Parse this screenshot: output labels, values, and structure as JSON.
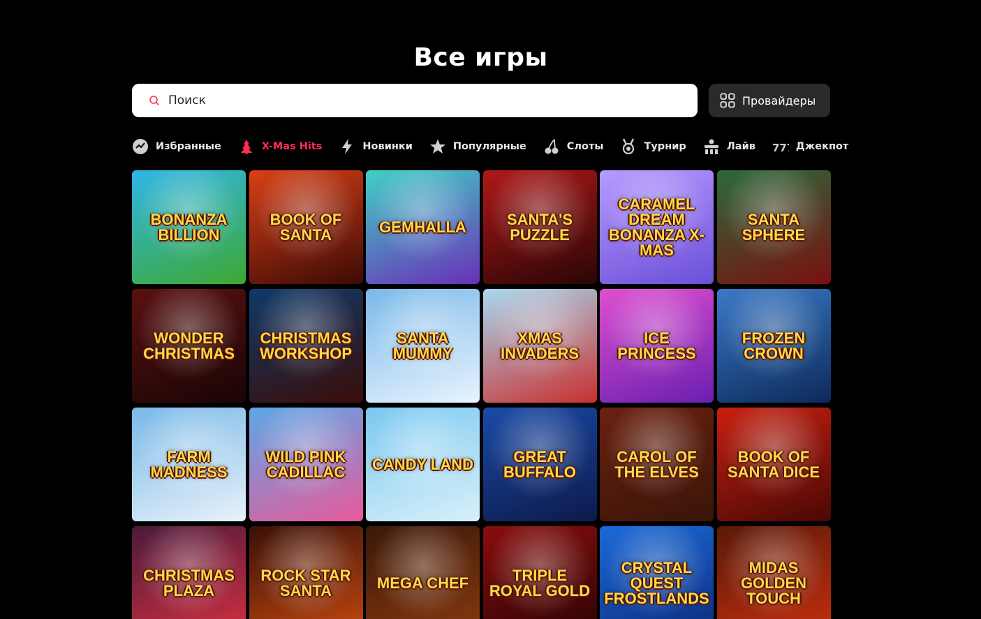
{
  "page": {
    "title": "Все игры"
  },
  "search": {
    "placeholder": "Поиск",
    "value": ""
  },
  "providers_button": {
    "label": "Провайдеры"
  },
  "accent_color": "#ff2d55",
  "categories": [
    {
      "label": "Избранные",
      "icon": "favorites-icon",
      "active": false
    },
    {
      "label": "X-Mas Hits",
      "icon": "christmas-tree-icon",
      "active": true
    },
    {
      "label": "Новинки",
      "icon": "lightning-icon",
      "active": false
    },
    {
      "label": "Популярные",
      "icon": "star-icon",
      "active": false
    },
    {
      "label": "Слоты",
      "icon": "cherry-icon",
      "active": false
    },
    {
      "label": "Турнир",
      "icon": "medal-icon",
      "active": false
    },
    {
      "label": "Лайв",
      "icon": "live-dealer-icon",
      "active": false
    },
    {
      "label": "Джекпот",
      "icon": "jackpot-777-icon",
      "active": false
    }
  ],
  "games": [
    {
      "title": "Bonanza Billion",
      "colors": [
        "#2fb6e8",
        "#3ea832"
      ]
    },
    {
      "title": "Book of Santa",
      "colors": [
        "#d94016",
        "#3c0a05"
      ]
    },
    {
      "title": "Gemhalla",
      "colors": [
        "#3fd1c4",
        "#6b2fb8"
      ]
    },
    {
      "title": "Santa's Puzzle",
      "colors": [
        "#b01818",
        "#2a0505"
      ]
    },
    {
      "title": "Caramel Dream Bonanza X-mas",
      "colors": [
        "#b79bff",
        "#6b4fd8"
      ]
    },
    {
      "title": "Santa Sphere",
      "colors": [
        "#2a6a3a",
        "#7a1010"
      ]
    },
    {
      "title": "Wonder Christmas",
      "colors": [
        "#5a1010",
        "#1a0505"
      ]
    },
    {
      "title": "Christmas Workshop",
      "colors": [
        "#0f3a6a",
        "#3a0d08"
      ]
    },
    {
      "title": "Santa Mummy",
      "colors": [
        "#7ab8e8",
        "#e8f4ff"
      ]
    },
    {
      "title": "Xmas Invaders",
      "colors": [
        "#a8d8f0",
        "#c83030"
      ]
    },
    {
      "title": "Ice Princess",
      "colors": [
        "#e04fd0",
        "#6a1fb0"
      ]
    },
    {
      "title": "Frozen Crown",
      "colors": [
        "#3a7ac8",
        "#0d2a5a"
      ]
    },
    {
      "title": "Farm Madness",
      "colors": [
        "#78b8e8",
        "#e8f2fa"
      ]
    },
    {
      "title": "Wild Pink Cadillac",
      "colors": [
        "#5aa8e8",
        "#e85a9a"
      ]
    },
    {
      "title": "Candy Land",
      "colors": [
        "#7ac8f0",
        "#d8f0fa"
      ]
    },
    {
      "title": "Great Buffalo",
      "colors": [
        "#1a4aa8",
        "#0d1a4a"
      ]
    },
    {
      "title": "Carol of the Elves",
      "colors": [
        "#6a2010",
        "#3a1508"
      ]
    },
    {
      "title": "Book of Santa Dice",
      "colors": [
        "#c82010",
        "#4a0805"
      ]
    },
    {
      "title": "Christmas Plaza",
      "colors": [
        "#4a1a3a",
        "#d83040"
      ]
    },
    {
      "title": "Rock Star Santa",
      "colors": [
        "#3a1008",
        "#c84a10"
      ]
    },
    {
      "title": "Mega Chef",
      "colors": [
        "#3a1808",
        "#8a3a10"
      ]
    },
    {
      "title": "Triple Royal Gold",
      "colors": [
        "#8a0d0d",
        "#2a0303"
      ]
    },
    {
      "title": "Crystal Quest Frostlands",
      "colors": [
        "#1a6ad8",
        "#0d2a7a"
      ]
    },
    {
      "title": "Midas Golden Touch",
      "colors": [
        "#5a1a08",
        "#c83010"
      ]
    }
  ]
}
